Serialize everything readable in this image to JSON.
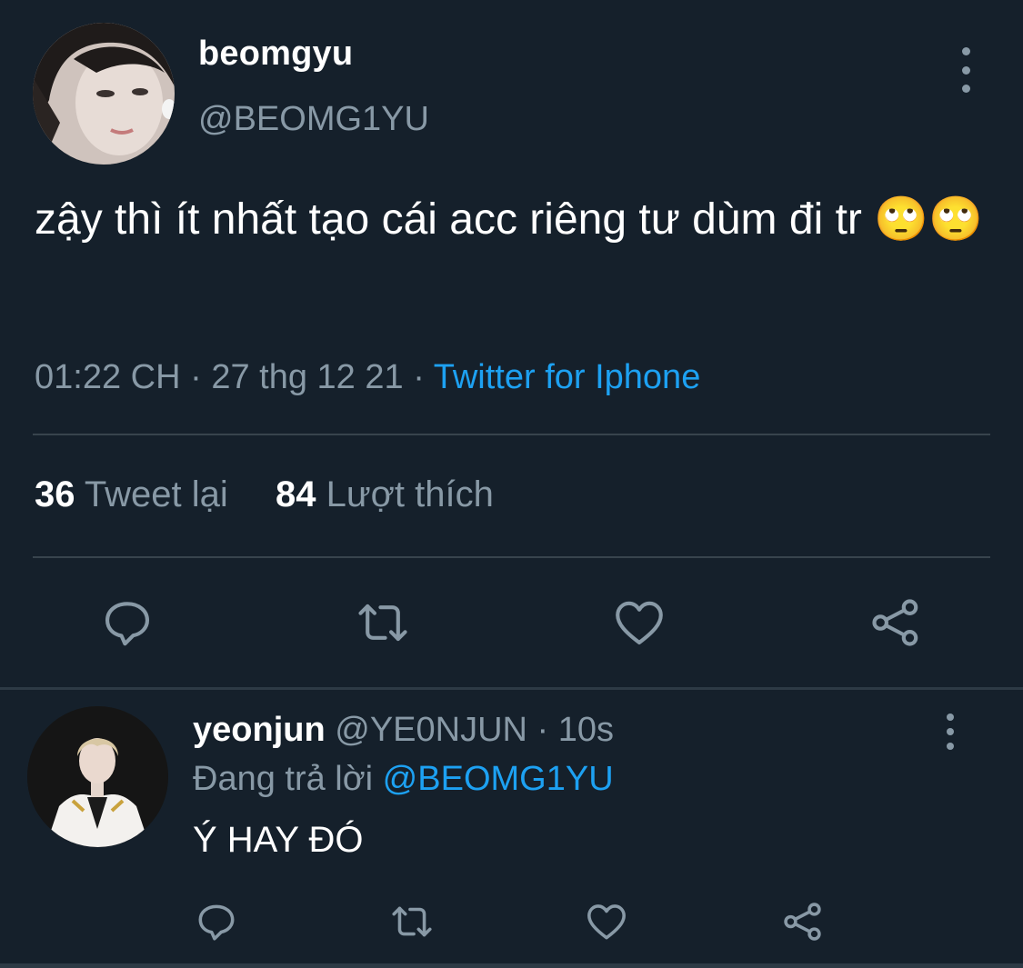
{
  "main_tweet": {
    "display_name": "beomgyu",
    "handle": "@BEOMG1YU",
    "text": "zậy thì ít nhất tạo cái acc riêng tư dùm đi tr 🙄🙄",
    "time": "01:22 CH",
    "separator": "·",
    "date": "27 thg 12 21",
    "source": "Twitter for Iphone",
    "retweet_count": "36",
    "retweet_label": "Tweet lại",
    "like_count": "84",
    "like_label": "Lượt thích",
    "actions": [
      "reply-icon",
      "retweet-icon",
      "like-icon",
      "share-icon"
    ]
  },
  "reply": {
    "display_name": "yeonjun",
    "handle": "@YE0NJUN",
    "separator": "·",
    "age": "10s",
    "replying_label": "Đang trả lời",
    "replying_to": "@BEOMG1YU",
    "text": "Ý HAY ĐÓ",
    "actions": [
      "reply-icon",
      "retweet-icon",
      "like-icon",
      "share-icon"
    ]
  },
  "colors": {
    "background": "#15202b",
    "text_primary": "#ffffff",
    "text_secondary": "#8899a6",
    "accent": "#1da1f2",
    "divider": "#38444d"
  }
}
